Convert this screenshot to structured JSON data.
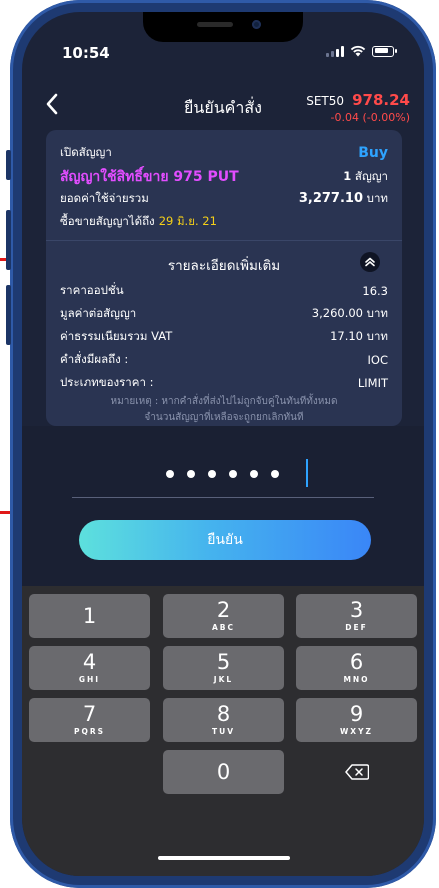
{
  "status": {
    "time": "10:54"
  },
  "header": {
    "title": "ยืนยันคำสั่ง",
    "index_name": "SET50",
    "index_value": "978.24",
    "index_change": "-0.04 (-0.00%)"
  },
  "order": {
    "action_label": "เปิดสัญญา",
    "side": "Buy",
    "contract": "สัญญาใช้สิทธิ์ขาย 975 PUT",
    "quantity": "1",
    "quantity_unit": "สัญญา",
    "total_label": "ยอดค่าใช้จ่ายรวม",
    "total_value": "3,277.10",
    "currency": "บาท",
    "trade_until_label": "ซื้อขายสัญญาได้ถึง",
    "trade_until_date": "29 มิ.ย. 21"
  },
  "details": {
    "title": "รายละเอียดเพิ่มเติม",
    "rows": [
      {
        "label": "ราคาออปชั่น",
        "value": "16.3",
        "unit": ""
      },
      {
        "label": "มูลค่าต่อสัญญา",
        "value": "3,260.00",
        "unit": "บาท"
      },
      {
        "label": "ค่าธรรมเนียมรวม VAT",
        "value": "17.10",
        "unit": "บาท"
      },
      {
        "label": "คำสั่งมีผลถึง :",
        "value": "IOC",
        "unit": ""
      },
      {
        "label": "ประเภทของราคา :",
        "value": "LIMIT",
        "unit": ""
      }
    ],
    "note_line1": "หมายเหตุ : หากคำสั่งที่ส่งไปไม่ถูกจับคู่ในทันทีทั้งหมด",
    "note_line2": "จำนวนสัญญาที่เหลือจะถูกยกเลิกทันที"
  },
  "pin": {
    "digits_entered": 6
  },
  "confirm": {
    "label": "ยืนยัน"
  },
  "keypad": {
    "keys": [
      {
        "num": "1",
        "letters": ""
      },
      {
        "num": "2",
        "letters": "ABC"
      },
      {
        "num": "3",
        "letters": "DEF"
      },
      {
        "num": "4",
        "letters": "GHI"
      },
      {
        "num": "5",
        "letters": "JKL"
      },
      {
        "num": "6",
        "letters": "MNO"
      },
      {
        "num": "7",
        "letters": "PQRS"
      },
      {
        "num": "8",
        "letters": "TUV"
      },
      {
        "num": "9",
        "letters": "WXYZ"
      },
      {
        "num": "0",
        "letters": ""
      }
    ]
  },
  "colors": {
    "accent": "#2ea3ff",
    "negative": "#ff4a4a",
    "contract": "#e24dff",
    "date": "#f5d018"
  },
  "icons": [
    "back-icon",
    "chevron-up-icon",
    "backspace-icon",
    "wifi-icon",
    "battery-icon",
    "signal-icon"
  ]
}
